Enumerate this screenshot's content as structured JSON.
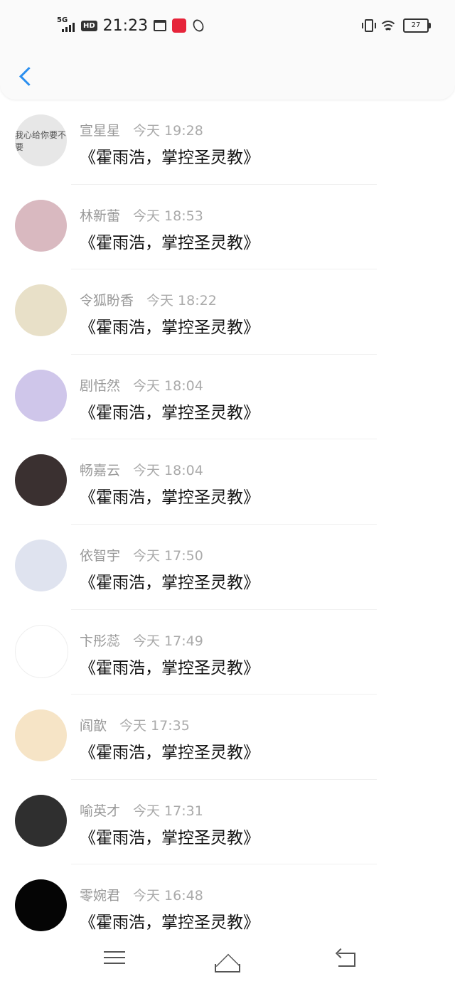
{
  "status_bar": {
    "network": "5G",
    "hd": "HD",
    "time": "21:23",
    "battery": "27"
  },
  "header": {
    "back_icon": "chevron-left-icon"
  },
  "comments": [
    {
      "name": "宣星星",
      "time": "今天 19:28",
      "text": "《霍雨浩，掌控圣灵教》",
      "avatar_bg": "#e7e7e7",
      "avatar_text": "我心给你要不要",
      "avatar_color": "#555"
    },
    {
      "name": "林新蕾",
      "time": "今天 18:53",
      "text": "《霍雨浩，掌控圣灵教》",
      "avatar_bg": "#d9b9c0",
      "avatar_text": "",
      "avatar_color": "#333"
    },
    {
      "name": "令狐盼香",
      "time": "今天 18:22",
      "text": "《霍雨浩，掌控圣灵教》",
      "avatar_bg": "#e8e0c8",
      "avatar_text": "",
      "avatar_color": "#222"
    },
    {
      "name": "剧恬然",
      "time": "今天 18:04",
      "text": "《霍雨浩，掌控圣灵教》",
      "avatar_bg": "#cfc6ea",
      "avatar_text": "",
      "avatar_color": "#333"
    },
    {
      "name": "畅嘉云",
      "time": "今天 18:04",
      "text": "《霍雨浩，掌控圣灵教》",
      "avatar_bg": "#3a3030",
      "avatar_text": "",
      "avatar_color": "#fff"
    },
    {
      "name": "依智宇",
      "time": "今天 17:50",
      "text": "《霍雨浩，掌控圣灵教》",
      "avatar_bg": "#dfe3ef",
      "avatar_text": "",
      "avatar_color": "#333"
    },
    {
      "name": "卞彤蕊",
      "time": "今天 17:49",
      "text": "《霍雨浩，掌控圣灵教》",
      "avatar_bg": "#ffffff",
      "avatar_text": "",
      "avatar_color": "#c0392b"
    },
    {
      "name": "阎歆",
      "time": "今天 17:35",
      "text": "《霍雨浩，掌控圣灵教》",
      "avatar_bg": "#f6e4c6",
      "avatar_text": "",
      "avatar_color": "#1e2a55"
    },
    {
      "name": "喻英才",
      "time": "今天 17:31",
      "text": "《霍雨浩，掌控圣灵教》",
      "avatar_bg": "#2f2f2f",
      "avatar_text": "",
      "avatar_color": "#fff"
    },
    {
      "name": "零婉君",
      "time": "今天 16:48",
      "text": "《霍雨浩，掌控圣灵教》",
      "avatar_bg": "#050505",
      "avatar_text": "",
      "avatar_color": "#fff"
    }
  ],
  "nav_bar": {
    "menu_icon": "menu-icon",
    "home_icon": "home-icon",
    "back_icon": "return-icon"
  }
}
